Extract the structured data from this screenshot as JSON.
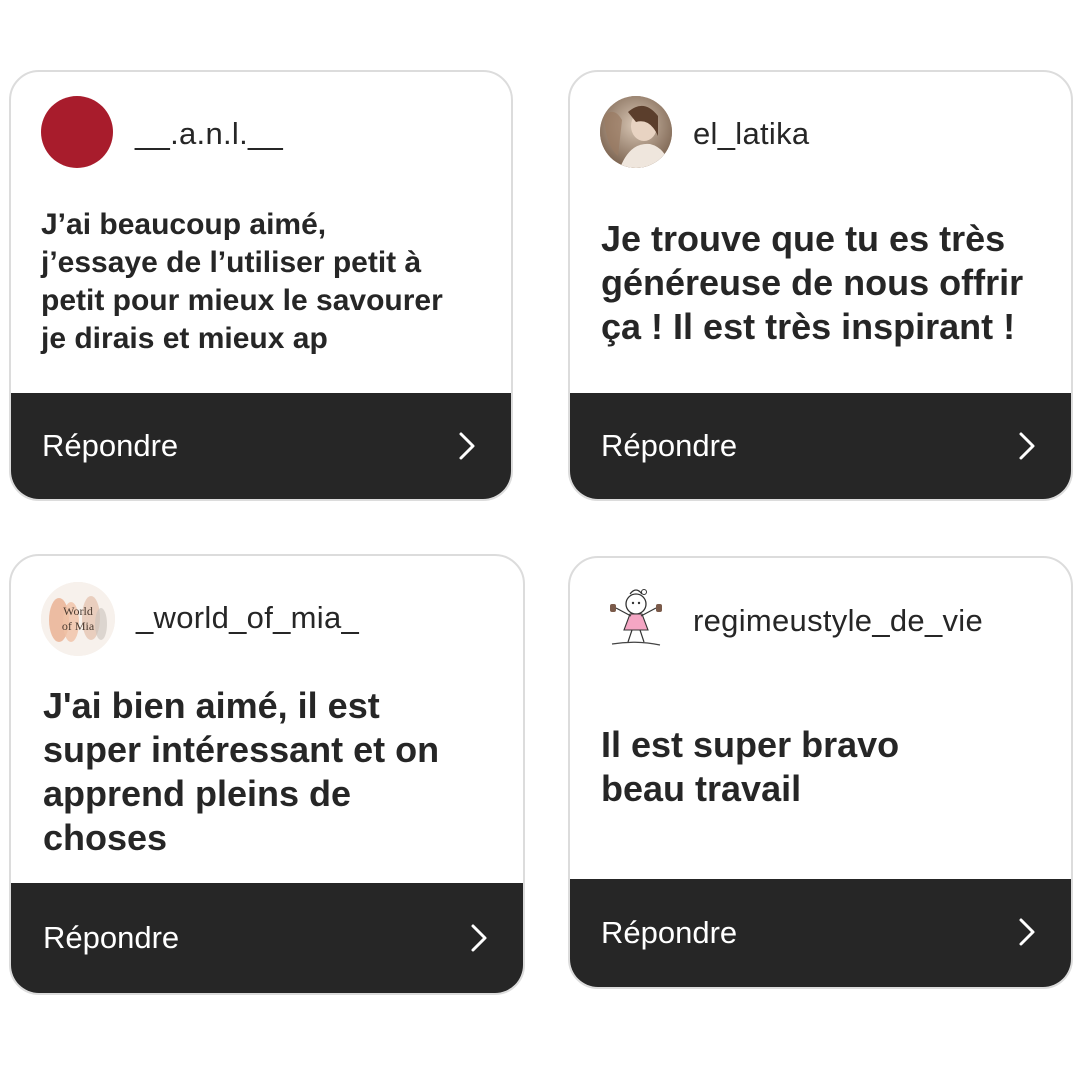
{
  "colors": {
    "bar_background": "#262626",
    "bar_text": "#ffffff",
    "text": "#262626",
    "card_border": "#dcdcdc",
    "avatar_anl": "#a81c2c"
  },
  "cards": [
    {
      "username": "__.a.n.l.__",
      "avatar_icon": "avatar-solid-red",
      "message": "J’ai beaucoup aimé,\nj’essaye de l’utiliser petit à\npetit pour mieux le savourer\nje dirais et mieux ap",
      "reply_label": "Répondre",
      "chevron_icon": "chevron-right-icon"
    },
    {
      "username": "el_latika",
      "avatar_icon": "avatar-photo",
      "message": "Je trouve que tu es très\ngénéreuse de nous offrir\nça ! Il est très inspirant !",
      "reply_label": "Répondre",
      "chevron_icon": "chevron-right-icon"
    },
    {
      "username": "_world_of_mia_",
      "avatar_icon": "avatar-logo",
      "avatar_logo_text_line1": "World",
      "avatar_logo_text_line2": "of Mia",
      "message": "J'ai bien aimé, il est\nsuper intéressant et on\napprend pleins de\nchoses",
      "reply_label": "Répondre",
      "chevron_icon": "chevron-right-icon"
    },
    {
      "username": "regimeustyle_de_vie",
      "avatar_icon": "avatar-illustration",
      "message": "Il est super bravo\nbeau travail",
      "reply_label": "Répondre",
      "chevron_icon": "chevron-right-icon"
    }
  ]
}
